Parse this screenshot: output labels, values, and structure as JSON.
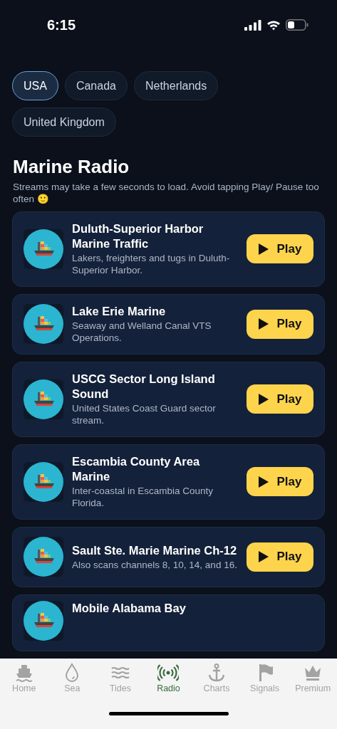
{
  "status_bar": {
    "time": "6:15"
  },
  "regions": [
    {
      "label": "USA",
      "selected": true
    },
    {
      "label": "Canada",
      "selected": false
    },
    {
      "label": "Netherlands",
      "selected": false
    },
    {
      "label": "United Kingdom",
      "selected": false
    }
  ],
  "heading": "Marine Radio",
  "notice": "Streams may take a few seconds to load. Avoid tapping Play/ Pause too often 🙂",
  "stations": [
    {
      "title": "Duluth-Superior Harbor Marine Traffic",
      "description": "Lakers, freighters and tugs in Duluth-Superior Harbor.",
      "button": "Play"
    },
    {
      "title": "Lake Erie Marine",
      "description": "Seaway and Welland Canal VTS Operations.",
      "button": "Play"
    },
    {
      "title": "USCG Sector Long Island Sound",
      "description": "United States Coast Guard sector stream.",
      "button": "Play"
    },
    {
      "title": "Escambia County Area Marine",
      "description": "Inter-coastal in Escambia County Florida.",
      "button": "Play"
    },
    {
      "title": "Sault Ste. Marie Marine Ch-12",
      "description": "Also scans channels 8, 10, 14, and 16.",
      "button": "Play"
    },
    {
      "title": "Mobile Alabama Bay"
    }
  ],
  "tab_bar": [
    {
      "label": "Home",
      "kind": "ship",
      "selected": false
    },
    {
      "label": "Sea",
      "kind": "drop",
      "selected": false
    },
    {
      "label": "Tides",
      "kind": "waves",
      "selected": false
    },
    {
      "label": "Radio",
      "kind": "radio",
      "selected": true
    },
    {
      "label": "Charts",
      "kind": "anchor",
      "selected": false
    },
    {
      "label": "Signals",
      "kind": "flag",
      "selected": false
    },
    {
      "label": "Premium",
      "kind": "crown",
      "selected": false
    }
  ]
}
